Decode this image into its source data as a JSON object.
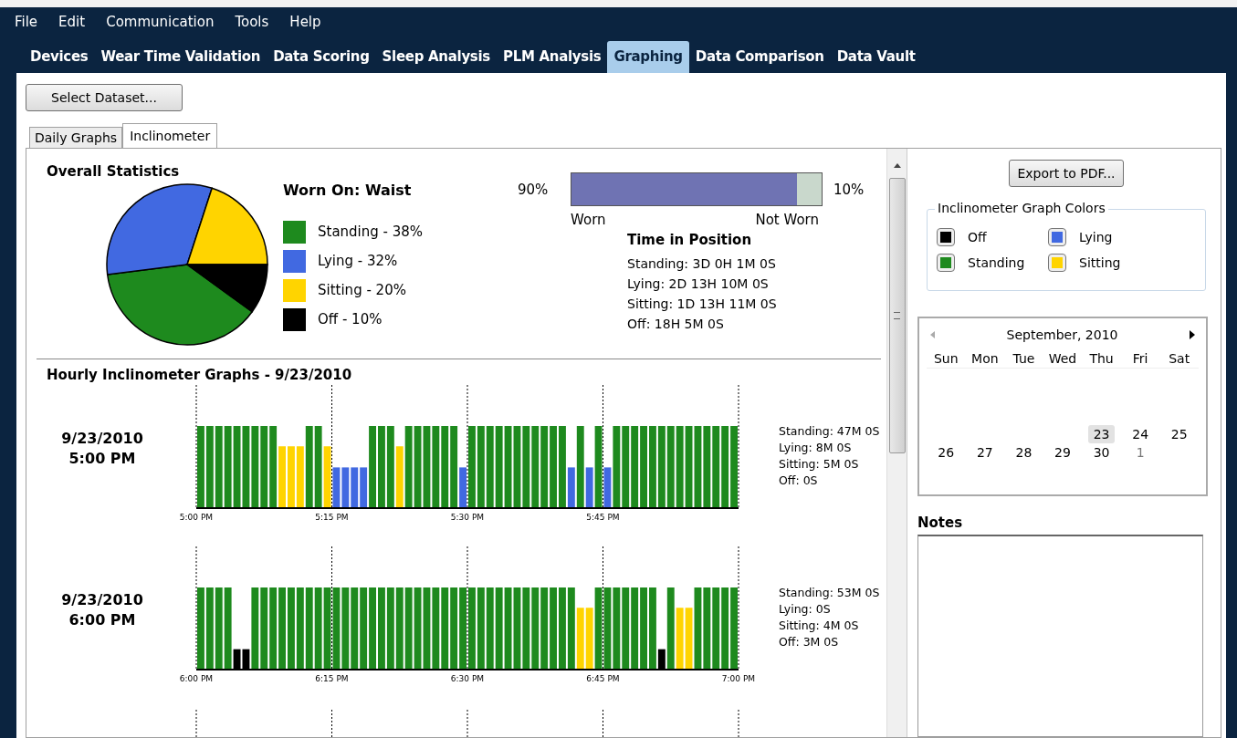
{
  "menu": [
    "File",
    "Edit",
    "Communication",
    "Tools",
    "Help"
  ],
  "tabs": [
    {
      "label": "Devices",
      "selected": false
    },
    {
      "label": "Wear Time Validation",
      "selected": false
    },
    {
      "label": "Data Scoring",
      "selected": false
    },
    {
      "label": "Sleep Analysis",
      "selected": false
    },
    {
      "label": "PLM Analysis",
      "selected": false
    },
    {
      "label": "Graphing",
      "selected": true
    },
    {
      "label": "Data Comparison",
      "selected": false
    },
    {
      "label": "Data Vault",
      "selected": false
    }
  ],
  "select_dataset_button": "Select Dataset...",
  "subtabs": [
    {
      "label": "Daily Graphs",
      "selected": false
    },
    {
      "label": "Inclinometer",
      "selected": true
    }
  ],
  "overall_statistics": {
    "title": "Overall Statistics",
    "chart_data": {
      "type": "pie",
      "values": [
        38,
        32,
        20,
        10
      ]
    },
    "worn_on": "Worn On: Waist",
    "legend": [
      {
        "label": "Standing - 38%",
        "color": "#1e8a1e"
      },
      {
        "label": "Lying - 32%",
        "color": "#4169e1"
      },
      {
        "label": "Sitting - 20%",
        "color": "#ffd400"
      },
      {
        "label": "Off - 10%",
        "color": "#000000"
      }
    ],
    "worn_bar": {
      "left_reading": "90%",
      "right_reading": "10%",
      "level": 0.9,
      "worn_label": "Worn",
      "not_worn_label": "Not Worn"
    },
    "time_in_position": {
      "title": "Time in Position",
      "lines": [
        "Standing: 3D 0H 1M 0S",
        "Lying: 2D 13H 10M 0S",
        "Sitting: 1D 13H 11M 0S",
        "Off: 18H 5M 0S"
      ]
    }
  },
  "hourly": {
    "title": "Hourly Inclinometer Graphs - 9/23/2010",
    "graphs": [
      {
        "date": "9/23/2010",
        "time": "5:00 PM",
        "ticks": [
          "5:00 PM",
          "5:15 PM",
          "5:30 PM",
          "5:45 PM"
        ],
        "minutes": [
          {
            "kind": "standing"
          },
          {
            "kind": "standing"
          },
          {
            "kind": "standing"
          },
          {
            "kind": "standing"
          },
          {
            "kind": "standing"
          },
          {
            "kind": "standing"
          },
          {
            "kind": "standing"
          },
          {
            "kind": "standing"
          },
          {
            "kind": "standing"
          },
          {
            "kind": "sitting"
          },
          {
            "kind": "sitting"
          },
          {
            "kind": "sitting"
          },
          {
            "kind": "standing"
          },
          {
            "kind": "standing"
          },
          {
            "kind": "sitting"
          },
          {
            "kind": "lying"
          },
          {
            "kind": "lying"
          },
          {
            "kind": "lying"
          },
          {
            "kind": "lying"
          },
          {
            "kind": "standing"
          },
          {
            "kind": "standing"
          },
          {
            "kind": "standing"
          },
          {
            "kind": "sitting"
          },
          {
            "kind": "standing"
          },
          {
            "kind": "standing"
          },
          {
            "kind": "standing"
          },
          {
            "kind": "standing"
          },
          {
            "kind": "standing"
          },
          {
            "kind": "standing"
          },
          {
            "kind": "lying"
          },
          {
            "kind": "standing"
          },
          {
            "kind": "standing"
          },
          {
            "kind": "standing"
          },
          {
            "kind": "standing"
          },
          {
            "kind": "standing"
          },
          {
            "kind": "standing"
          },
          {
            "kind": "standing"
          },
          {
            "kind": "standing"
          },
          {
            "kind": "standing"
          },
          {
            "kind": "standing"
          },
          {
            "kind": "standing"
          },
          {
            "kind": "lying"
          },
          {
            "kind": "standing"
          },
          {
            "kind": "lying"
          },
          {
            "kind": "standing"
          },
          {
            "kind": "lying"
          },
          {
            "kind": "standing"
          },
          {
            "kind": "standing"
          },
          {
            "kind": "standing"
          },
          {
            "kind": "standing"
          },
          {
            "kind": "standing"
          },
          {
            "kind": "standing"
          },
          {
            "kind": "standing"
          },
          {
            "kind": "standing"
          },
          {
            "kind": "standing"
          },
          {
            "kind": "standing"
          },
          {
            "kind": "standing"
          },
          {
            "kind": "standing"
          },
          {
            "kind": "standing"
          },
          {
            "kind": "standing"
          }
        ],
        "summary": [
          "Standing: 47M 0S",
          "Lying: 8M 0S",
          "Sitting: 5M 0S",
          "Off: 0S"
        ]
      },
      {
        "date": "9/23/2010",
        "time": "6:00 PM",
        "ticks": [
          "6:00 PM",
          "6:15 PM",
          "6:30 PM",
          "6:45 PM",
          "7:00 PM"
        ],
        "minutes": [
          {
            "kind": "standing"
          },
          {
            "kind": "standing"
          },
          {
            "kind": "standing"
          },
          {
            "kind": "standing"
          },
          {
            "kind": "off"
          },
          {
            "kind": "off"
          },
          {
            "kind": "standing"
          },
          {
            "kind": "standing"
          },
          {
            "kind": "standing"
          },
          {
            "kind": "standing"
          },
          {
            "kind": "standing"
          },
          {
            "kind": "standing"
          },
          {
            "kind": "standing"
          },
          {
            "kind": "standing"
          },
          {
            "kind": "standing"
          },
          {
            "kind": "standing"
          },
          {
            "kind": "standing"
          },
          {
            "kind": "standing"
          },
          {
            "kind": "standing"
          },
          {
            "kind": "standing"
          },
          {
            "kind": "standing"
          },
          {
            "kind": "standing"
          },
          {
            "kind": "standing"
          },
          {
            "kind": "standing"
          },
          {
            "kind": "standing"
          },
          {
            "kind": "standing"
          },
          {
            "kind": "standing"
          },
          {
            "kind": "standing"
          },
          {
            "kind": "standing"
          },
          {
            "kind": "standing"
          },
          {
            "kind": "standing"
          },
          {
            "kind": "standing"
          },
          {
            "kind": "standing"
          },
          {
            "kind": "standing"
          },
          {
            "kind": "standing"
          },
          {
            "kind": "standing"
          },
          {
            "kind": "standing"
          },
          {
            "kind": "standing"
          },
          {
            "kind": "standing"
          },
          {
            "kind": "standing"
          },
          {
            "kind": "standing"
          },
          {
            "kind": "standing"
          },
          {
            "kind": "sitting"
          },
          {
            "kind": "sitting"
          },
          {
            "kind": "standing"
          },
          {
            "kind": "standing"
          },
          {
            "kind": "standing"
          },
          {
            "kind": "standing"
          },
          {
            "kind": "standing"
          },
          {
            "kind": "standing"
          },
          {
            "kind": "standing"
          },
          {
            "kind": "off"
          },
          {
            "kind": "standing"
          },
          {
            "kind": "sitting"
          },
          {
            "kind": "sitting"
          },
          {
            "kind": "standing"
          },
          {
            "kind": "standing"
          },
          {
            "kind": "standing"
          },
          {
            "kind": "standing"
          },
          {
            "kind": "standing"
          }
        ],
        "summary": [
          "Standing: 53M 0S",
          "Lying: 0S",
          "Sitting: 4M 0S",
          "Off: 3M 0S"
        ]
      }
    ]
  },
  "export_button": "Export to PDF...",
  "graph_colors": {
    "title": "Inclinometer Graph Colors",
    "items": [
      {
        "label": "Off",
        "color": "#000000"
      },
      {
        "label": "Lying",
        "color": "#4169e1"
      },
      {
        "label": "Standing",
        "color": "#1e8a1e"
      },
      {
        "label": "Sitting",
        "color": "#ffd400"
      }
    ]
  },
  "calendar": {
    "month": "September, 2010",
    "weekdays": [
      "Sun",
      "Mon",
      "Tue",
      "Wed",
      "Thu",
      "Fri",
      "Sat"
    ],
    "weeks": [
      [
        {
          "day": "23",
          "selected": true,
          "other_month": false
        },
        {
          "day": "24",
          "selected": false,
          "other_month": false
        },
        {
          "day": "25",
          "selected": false,
          "other_month": false
        }
      ],
      [
        {
          "day": "26",
          "selected": false,
          "other_month": false
        },
        {
          "day": "27",
          "selected": false,
          "other_month": false
        },
        {
          "day": "28",
          "selected": false,
          "other_month": false
        },
        {
          "day": "29",
          "selected": false,
          "other_month": false
        },
        {
          "day": "30",
          "selected": false,
          "other_month": false
        },
        {
          "day": "1",
          "selected": false,
          "other_month": true
        }
      ]
    ]
  },
  "notes": {
    "title": "Notes"
  }
}
